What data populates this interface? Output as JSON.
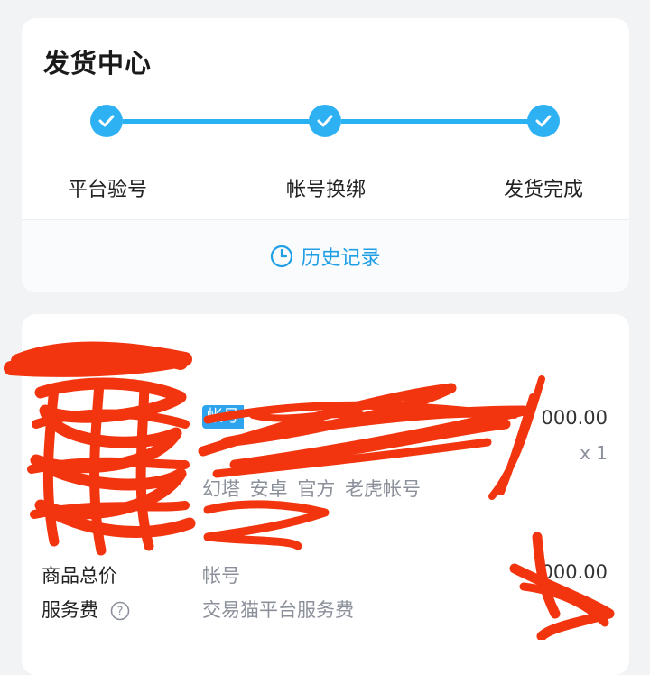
{
  "delivery": {
    "title": "发货中心",
    "steps": [
      {
        "label": "平台验号",
        "status": "done"
      },
      {
        "label": "帐号换绑",
        "status": "done"
      },
      {
        "label": "发货完成",
        "status": "done"
      }
    ],
    "history_label": "历史记录"
  },
  "order": {
    "item": {
      "tag": "帐号",
      "price": "000.00",
      "quantity": "x 1",
      "tags": "幻塔 安卓 官方 老虎帐号"
    },
    "summary": {
      "total_label": "商品总价",
      "total_desc": "帐号",
      "total_value": "000.00",
      "fee_label": "服务费",
      "fee_desc": "交易猫平台服务费"
    }
  },
  "colors": {
    "accent": "#2db1f3",
    "link": "#1e9fe6",
    "redaction": "#f2350f"
  }
}
